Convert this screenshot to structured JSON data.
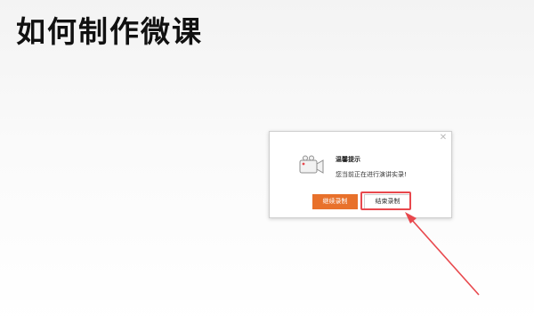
{
  "page": {
    "title": "如何制作微课"
  },
  "dialog": {
    "close_icon": "close-icon",
    "icon": "video-camera-icon",
    "heading": "温馨提示",
    "message": "您当前正在进行演讲实录!",
    "continue_label": "继续录制",
    "end_label": "结束录制"
  },
  "annotation": {
    "highlight_color": "#e8484d",
    "arrow_color": "#e8484d"
  },
  "colors": {
    "accent": "#e8712b"
  }
}
